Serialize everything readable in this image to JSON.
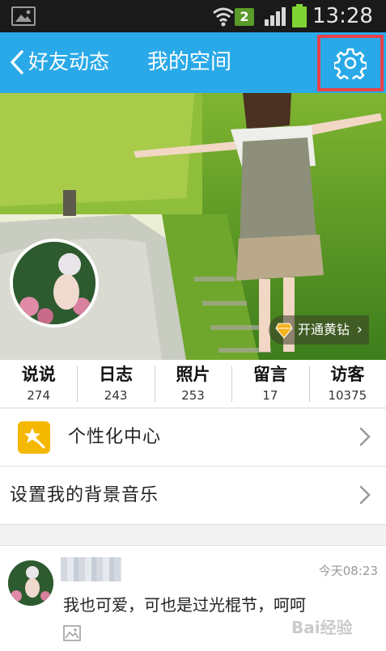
{
  "status_bar": {
    "time": "13:28",
    "notification_count": "2",
    "icons": [
      "gallery-icon",
      "wifi-icon",
      "signal-icon",
      "battery-icon"
    ]
  },
  "header": {
    "back_label": "好友动态",
    "title": "我的空间",
    "settings_icon": "gear-icon",
    "background_color": "#2aa9e8",
    "highlight_color": "#e8414b"
  },
  "cover": {
    "vip_label": "开通黄钻"
  },
  "stats": [
    {
      "label": "说说",
      "count": "274"
    },
    {
      "label": "日志",
      "count": "243"
    },
    {
      "label": "照片",
      "count": "253"
    },
    {
      "label": "留言",
      "count": "17"
    },
    {
      "label": "访客",
      "count": "10375"
    }
  ],
  "menu": [
    {
      "label": "个性化中心",
      "icon": "star-wand-icon"
    },
    {
      "label": "设置我的背景音乐"
    }
  ],
  "feed": {
    "time": "今天08:23",
    "text": "我也可爱，可也是过光棍节，呵呵"
  },
  "watermark": "Bai经验"
}
